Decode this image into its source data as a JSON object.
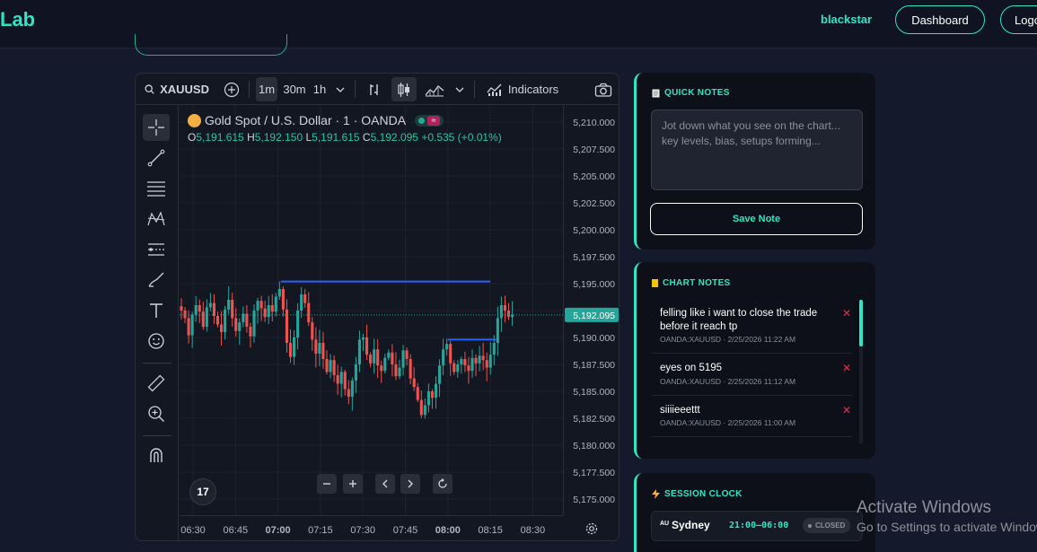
{
  "nav": {
    "brand": "Lab",
    "user": "blackstar",
    "dashboard_label": "Dashboard",
    "logout_label": "Logo"
  },
  "chart_toolbar": {
    "symbol": "XAUUSD",
    "intervals": [
      "1m",
      "30m",
      "1h"
    ],
    "active_interval": "1m",
    "indicators_label": "Indicators"
  },
  "chart_legend": {
    "title": "Gold Spot / U.S. Dollar · 1 · OANDA",
    "open_label": "O",
    "open": "5,191.615",
    "high_label": "H",
    "high": "5,192.150",
    "low_label": "L",
    "low": "5,191.615",
    "close_label": "C",
    "close": "5,192.095",
    "change": "+0.535 (+0.01%)"
  },
  "chart_data": {
    "type": "candlestick",
    "ylim": [
      5173.5,
      5211.5
    ],
    "y_ticks": [
      "5,210.000",
      "5,207.500",
      "5,205.000",
      "5,202.500",
      "5,200.000",
      "5,197.500",
      "5,195.000",
      "5,192.500",
      "5,190.000",
      "5,187.500",
      "5,185.000",
      "5,182.500",
      "5,180.000",
      "5,177.500",
      "5,175.000"
    ],
    "x_ticks": [
      "06:30",
      "06:45",
      "07:00",
      "07:15",
      "07:30",
      "07:45",
      "08:00",
      "08:15",
      "08:30"
    ],
    "last_price": 5192.095,
    "last_price_label": "5,192.095",
    "horizontal_lines": [
      {
        "price": 5195.2,
        "from": "07:01",
        "to": "08:15"
      },
      {
        "price": 5189.8,
        "from": "08:00",
        "to": "08:17"
      }
    ],
    "closes": [
      5192.5,
      5191.8,
      5190.2,
      5192.1,
      5193.0,
      5192.4,
      5191.0,
      5192.8,
      5193.2,
      5192.0,
      5191.2,
      5190.5,
      5192.6,
      5193.5,
      5191.8,
      5190.6,
      5191.4,
      5192.2,
      5191.0,
      5190.1,
      5192.5,
      5193.4,
      5192.7,
      5191.9,
      5193.0,
      5192.4,
      5193.8,
      5194.5,
      5192.6,
      5189.5,
      5188.2,
      5190.0,
      5192.5,
      5194.0,
      5193.2,
      5191.4,
      5189.8,
      5188.5,
      5189.5,
      5188.0,
      5186.8,
      5187.9,
      5186.5,
      5185.7,
      5186.8,
      5185.2,
      5184.5,
      5186.0,
      5187.5,
      5189.8,
      5190.0,
      5188.4,
      5187.6,
      5188.9,
      5187.4,
      5186.9,
      5188.1,
      5188.6,
      5187.5,
      5186.4,
      5187.2,
      5188.8,
      5188.0,
      5186.2,
      5185.4,
      5184.2,
      5182.8,
      5183.7,
      5185.0,
      5184.4,
      5185.7,
      5187.4,
      5188.9,
      5189.4,
      5187.6,
      5186.8,
      5187.5,
      5188.0,
      5187.4,
      5186.9,
      5188.1,
      5187.6,
      5188.3,
      5187.9,
      5187.2,
      5188.4,
      5189.5,
      5191.8,
      5193.0,
      5192.5,
      5191.9,
      5192.095
    ]
  },
  "quick_notes": {
    "title": "QUICK NOTES",
    "placeholder": "Jot down what you see on the chart... key levels, bias, setups forming...",
    "save_label": "Save Note"
  },
  "chart_notes": {
    "title": "CHART NOTES",
    "items": [
      {
        "text": "felling like i want to close the trade before it reach tp",
        "meta": "OANDA:XAUUSD · 2/25/2026 11:22 AM"
      },
      {
        "text": "eyes on 5195",
        "meta": "OANDA:XAUUSD · 2/25/2026 11:12 AM"
      },
      {
        "text": "siiiieeettt",
        "meta": "OANDA:XAUUSD · 2/25/2026 11:00 AM"
      }
    ]
  },
  "session_clock": {
    "title": "SESSION CLOCK",
    "rows": [
      {
        "flag": "AU",
        "name": "Sydney",
        "hours": "21:00–06:00",
        "status": "CLOSED"
      }
    ]
  },
  "watermark": {
    "line1": "Activate Windows",
    "line2": "Go to Settings to activate Windows."
  },
  "colors": {
    "accent": "#2ee6c5",
    "up": "#26a69a",
    "down": "#ef5350",
    "line": "#2962ff"
  }
}
